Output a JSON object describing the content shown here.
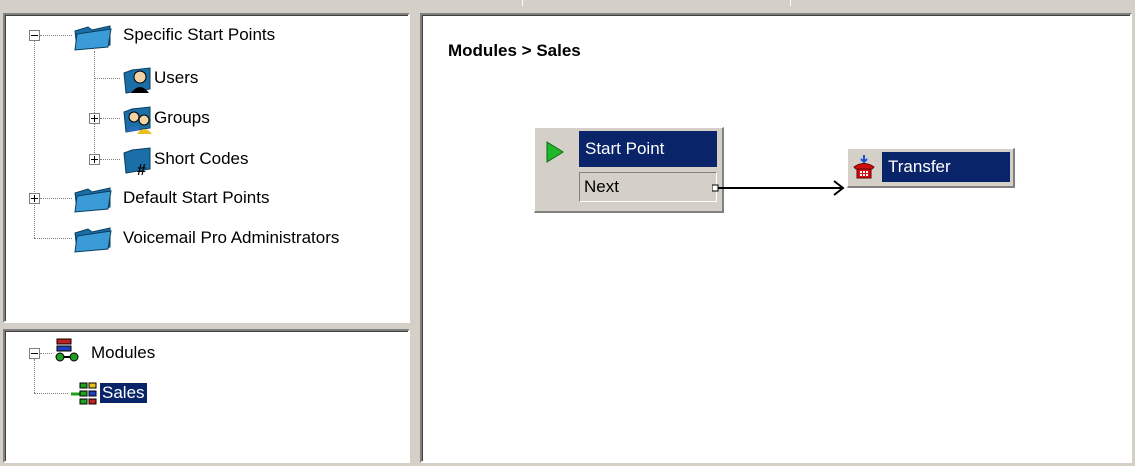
{
  "tree": {
    "items": [
      {
        "label": "Specific Start Points",
        "expander": "minus"
      },
      {
        "label": "Users"
      },
      {
        "label": "Groups",
        "expander": "plus"
      },
      {
        "label": "Short Codes",
        "expander": "plus"
      },
      {
        "label": "Default Start Points",
        "expander": "plus"
      },
      {
        "label": "Voicemail Pro Administrators"
      }
    ]
  },
  "modules_tree": {
    "root_label": "Modules",
    "child_label": "Sales"
  },
  "canvas": {
    "breadcrumb": "Modules > Sales",
    "start_node": {
      "title": "Start Point",
      "exit": "Next"
    },
    "transfer_node": {
      "title": "Transfer"
    }
  },
  "colors": {
    "selection": "#0a246a",
    "face": "#d4d0c8",
    "folder": "#1a6fa8",
    "start_arrow": "#1fb82a",
    "transfer_icon": "#d01010"
  }
}
